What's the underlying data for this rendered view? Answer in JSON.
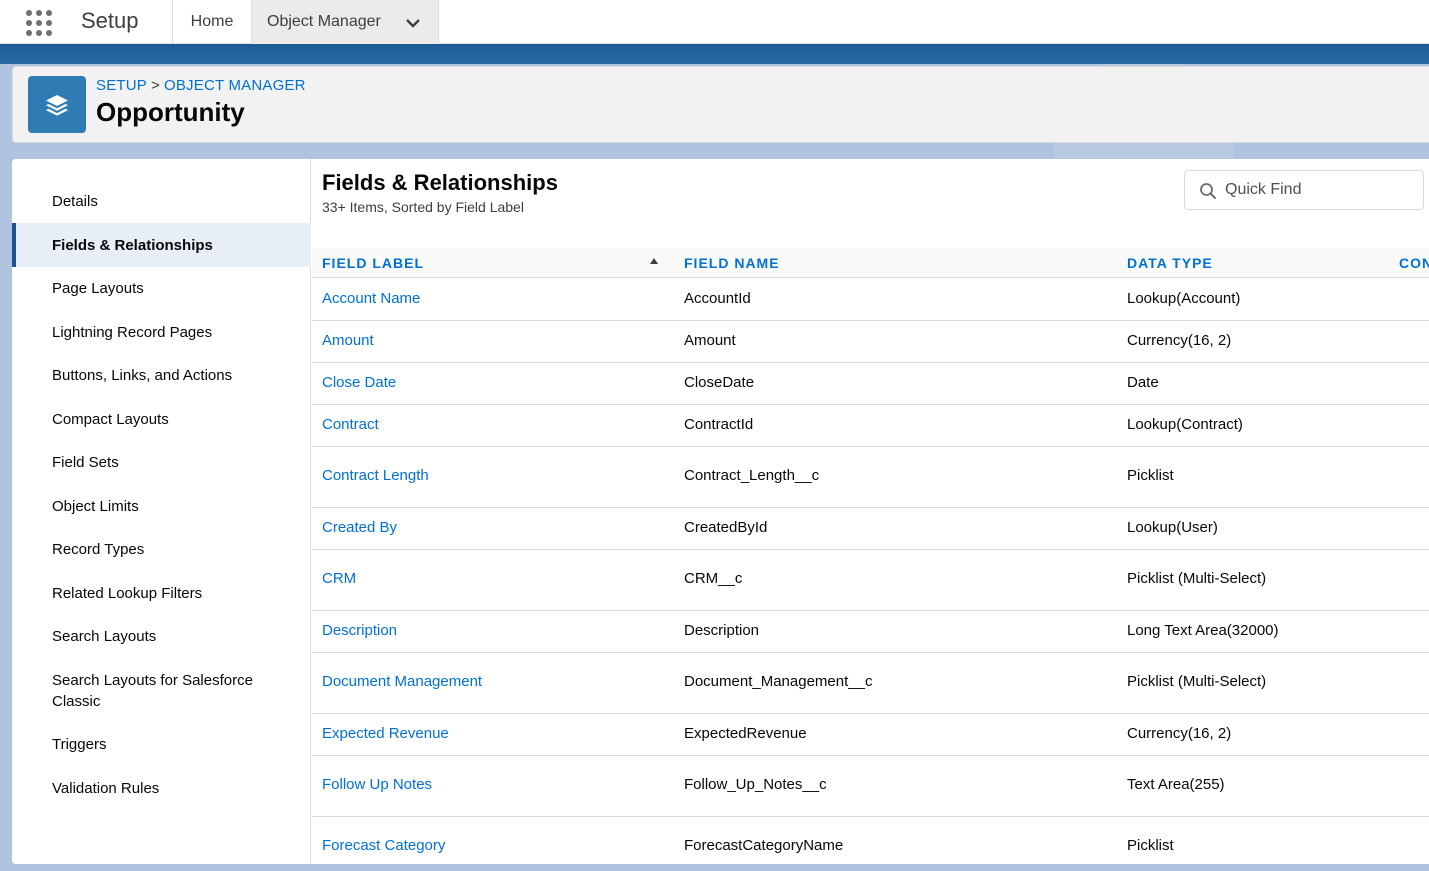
{
  "topbar": {
    "app_name": "Setup",
    "tabs": [
      {
        "label": "Home"
      },
      {
        "label": "Object Manager"
      }
    ]
  },
  "header": {
    "breadcrumb": [
      "SETUP",
      "OBJECT MANAGER"
    ],
    "breadcrumb_separator": ">",
    "title": "Opportunity",
    "icon": "layers-icon"
  },
  "sidebar": {
    "items": [
      {
        "label": "Details"
      },
      {
        "label": "Fields & Relationships",
        "active": true
      },
      {
        "label": "Page Layouts"
      },
      {
        "label": "Lightning Record Pages"
      },
      {
        "label": "Buttons, Links, and Actions"
      },
      {
        "label": "Compact Layouts"
      },
      {
        "label": "Field Sets"
      },
      {
        "label": "Object Limits"
      },
      {
        "label": "Record Types"
      },
      {
        "label": "Related Lookup Filters"
      },
      {
        "label": "Search Layouts"
      },
      {
        "label": "Search Layouts for Salesforce Classic"
      },
      {
        "label": "Triggers"
      },
      {
        "label": "Validation Rules"
      }
    ]
  },
  "main": {
    "title": "Fields & Relationships",
    "subtitle": "33+ Items, Sorted by Field Label",
    "search": {
      "placeholder": "Quick Find",
      "value": ""
    },
    "columns": [
      "FIELD LABEL",
      "FIELD NAME",
      "DATA TYPE",
      "CON"
    ],
    "sorted_column": "FIELD LABEL",
    "sort_direction": "ascending",
    "rows": [
      {
        "label": "Account Name",
        "name": "AccountId",
        "type": "Lookup(Account)"
      },
      {
        "label": "Amount",
        "name": "Amount",
        "type": "Currency(16, 2)"
      },
      {
        "label": "Close Date",
        "name": "CloseDate",
        "type": "Date"
      },
      {
        "label": "Contract",
        "name": "ContractId",
        "type": "Lookup(Contract)"
      },
      {
        "label": "Contract Length",
        "name": "Contract_Length__c",
        "type": "Picklist"
      },
      {
        "label": "Created By",
        "name": "CreatedById",
        "type": "Lookup(User)"
      },
      {
        "label": "CRM",
        "name": "CRM__c",
        "type": "Picklist (Multi-Select)"
      },
      {
        "label": "Description",
        "name": "Description",
        "type": "Long Text Area(32000)"
      },
      {
        "label": "Document Management",
        "name": "Document_Management__c",
        "type": "Picklist (Multi-Select)"
      },
      {
        "label": "Expected Revenue",
        "name": "ExpectedRevenue",
        "type": "Currency(16, 2)"
      },
      {
        "label": "Follow Up Notes",
        "name": "Follow_Up_Notes__c",
        "type": "Text Area(255)"
      },
      {
        "label": "Forecast Category",
        "name": "ForecastCategoryName",
        "type": "Picklist"
      }
    ]
  },
  "colors": {
    "link": "#0070d2",
    "brand_band": "#1c5c92",
    "header_icon": "#2f7bb4",
    "active_nav_bg": "#e8eef7",
    "active_nav_border": "#1b5297"
  }
}
